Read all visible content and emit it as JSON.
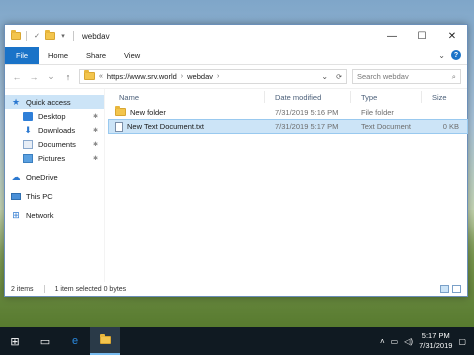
{
  "window": {
    "title": "webdav"
  },
  "ribbon": {
    "tabs": [
      "File",
      "Home",
      "Share",
      "View"
    ]
  },
  "address": {
    "prefix": "«",
    "crumbs": [
      "https://www.srv.world",
      "webdav"
    ]
  },
  "search": {
    "placeholder": "Search webdav"
  },
  "nav": {
    "quick_access": "Quick access",
    "items": [
      "Desktop",
      "Downloads",
      "Documents",
      "Pictures"
    ],
    "onedrive": "OneDrive",
    "this_pc": "This PC",
    "network": "Network"
  },
  "columns": {
    "name": "Name",
    "date": "Date modified",
    "type": "Type",
    "size": "Size"
  },
  "files": [
    {
      "name": "New folder",
      "date": "7/31/2019 5:16 PM",
      "type": "File folder",
      "size": "",
      "icon": "folder-icon"
    },
    {
      "name": "New Text Document.txt",
      "date": "7/31/2019 5:17 PM",
      "type": "Text Document",
      "size": "0 KB",
      "icon": "text-file-icon"
    }
  ],
  "status": {
    "items": "2 items",
    "selected": "1 item selected  0 bytes"
  },
  "taskbar": {
    "time": "5:17 PM",
    "date": "7/31/2019"
  },
  "colors": {
    "accent": "#1a73c8",
    "selection": "#cce4f7",
    "taskbar": "#101a22"
  }
}
